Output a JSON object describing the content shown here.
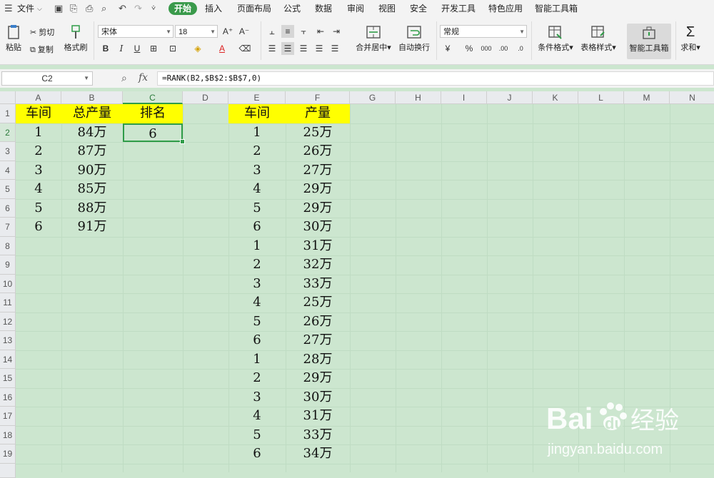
{
  "menubar": {
    "file_label": "文件",
    "tabs": [
      "开始",
      "插入",
      "页面布局",
      "公式",
      "数据",
      "审阅",
      "视图",
      "安全",
      "开发工具",
      "特色应用",
      "智能工具箱"
    ],
    "active_tab": "开始"
  },
  "toolbar": {
    "paste": "粘贴",
    "cut": "剪切",
    "copy": "复制",
    "format_painter": "格式刷",
    "font_name": "宋体",
    "font_size": "18",
    "merge_center": "合并居中",
    "wrap_text": "自动换行",
    "number_format": "常规",
    "conditional_format": "条件格式",
    "table_style": "表格样式",
    "smart_toolbox": "智能工具箱",
    "sum": "求和"
  },
  "formula_bar": {
    "name_box": "C2",
    "fx_label": "fx",
    "formula": "=RANK(B2,$B$2:$B$7,0)"
  },
  "columns": [
    "A",
    "B",
    "C",
    "D",
    "E",
    "F",
    "G",
    "H",
    "I",
    "J",
    "K",
    "L",
    "M",
    "N"
  ],
  "rows": [
    "1",
    "2",
    "3",
    "4",
    "5",
    "6",
    "7",
    "8",
    "9",
    "10",
    "11",
    "12",
    "13",
    "14",
    "15",
    "16",
    "17",
    "18",
    "19"
  ],
  "selected_cell": "C2",
  "table1": {
    "headers": [
      "车间",
      "总产量",
      "排名"
    ],
    "rows": [
      [
        "1",
        "84万",
        "6"
      ],
      [
        "2",
        "87万",
        ""
      ],
      [
        "3",
        "90万",
        ""
      ],
      [
        "4",
        "85万",
        ""
      ],
      [
        "5",
        "88万",
        ""
      ],
      [
        "6",
        "91万",
        ""
      ]
    ]
  },
  "table2": {
    "headers": [
      "车间",
      "产量"
    ],
    "rows": [
      [
        "1",
        "25万"
      ],
      [
        "2",
        "26万"
      ],
      [
        "3",
        "27万"
      ],
      [
        "4",
        "29万"
      ],
      [
        "5",
        "29万"
      ],
      [
        "6",
        "30万"
      ],
      [
        "1",
        "31万"
      ],
      [
        "2",
        "32万"
      ],
      [
        "3",
        "33万"
      ],
      [
        "4",
        "25万"
      ],
      [
        "5",
        "26万"
      ],
      [
        "6",
        "27万"
      ],
      [
        "1",
        "28万"
      ],
      [
        "2",
        "29万"
      ],
      [
        "3",
        "30万"
      ],
      [
        "4",
        "31万"
      ],
      [
        "5",
        "33万"
      ],
      [
        "6",
        "34万"
      ]
    ]
  },
  "watermark": {
    "brand": "Bai",
    "brand2": "du",
    "cn": "经验",
    "url": "jingyan.baidu.com"
  },
  "colors": {
    "accent": "#3a9a4b",
    "sheet_bg": "#cce6cf",
    "header_fill": "#ffff00"
  }
}
